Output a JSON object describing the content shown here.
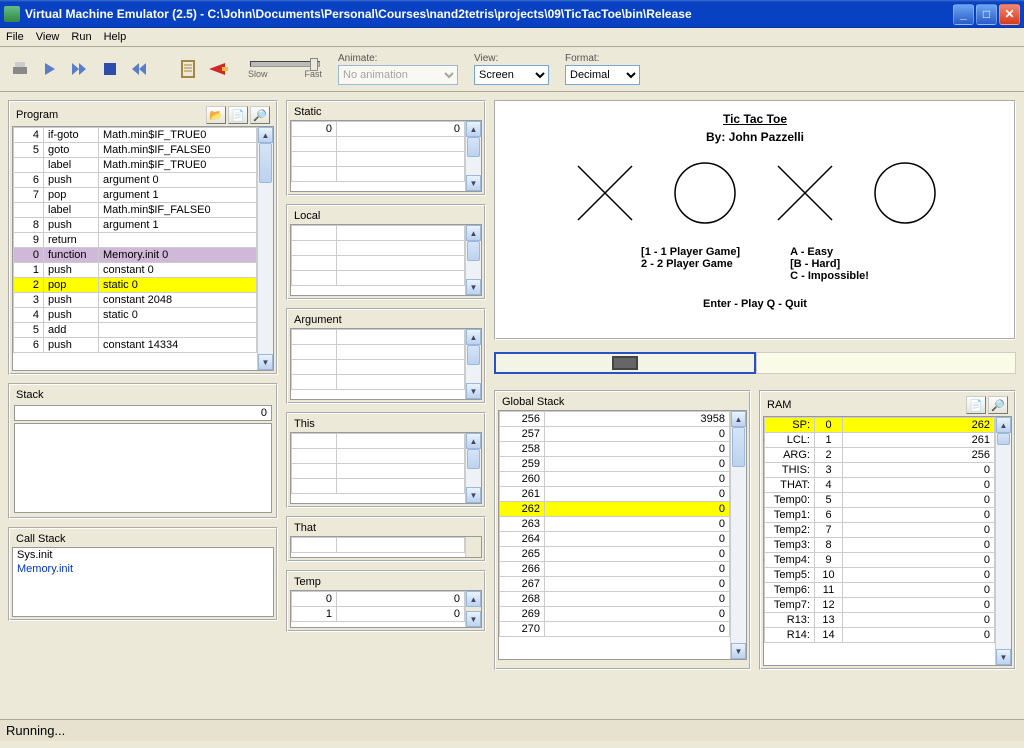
{
  "window": {
    "title": "Virtual Machine Emulator (2.5) - C:\\John\\Documents\\Personal\\Courses\\nand2tetris\\projects\\09\\TicTacToe\\bin\\Release"
  },
  "menu": {
    "file": "File",
    "view": "View",
    "run": "Run",
    "help": "Help"
  },
  "toolbar": {
    "animate": "Animate:",
    "no_animation": "No animation",
    "view": "View:",
    "screen": "Screen",
    "format": "Format:",
    "decimal": "Decimal",
    "slow": "Slow",
    "fast": "Fast"
  },
  "panels": {
    "program": "Program",
    "static": "Static",
    "local": "Local",
    "argument": "Argument",
    "this": "This",
    "that": "That",
    "temp": "Temp",
    "stack": "Stack",
    "callstack": "Call Stack",
    "globalstack": "Global Stack",
    "ram": "RAM"
  },
  "program": {
    "rows": [
      {
        "i": "4",
        "op": "if-goto",
        "arg": "Math.min$IF_TRUE0"
      },
      {
        "i": "5",
        "op": "goto",
        "arg": "Math.min$IF_FALSE0"
      },
      {
        "i": "",
        "op": "label",
        "arg": "Math.min$IF_TRUE0"
      },
      {
        "i": "6",
        "op": "push",
        "arg": "argument 0"
      },
      {
        "i": "7",
        "op": "pop",
        "arg": "argument 1"
      },
      {
        "i": "",
        "op": "label",
        "arg": "Math.min$IF_FALSE0"
      },
      {
        "i": "8",
        "op": "push",
        "arg": "argument 1"
      },
      {
        "i": "9",
        "op": "return",
        "arg": ""
      },
      {
        "i": "0",
        "op": "function",
        "arg": "Memory.init 0",
        "cls": "hl-purple"
      },
      {
        "i": "1",
        "op": "push",
        "arg": "constant 0"
      },
      {
        "i": "2",
        "op": "pop",
        "arg": "static 0",
        "cls": "hl-yellow"
      },
      {
        "i": "3",
        "op": "push",
        "arg": "constant 2048"
      },
      {
        "i": "4",
        "op": "push",
        "arg": "static 0"
      },
      {
        "i": "5",
        "op": "add",
        "arg": ""
      },
      {
        "i": "6",
        "op": "push",
        "arg": "constant 14334"
      }
    ]
  },
  "static": [
    {
      "k": "0",
      "v": "0"
    },
    {
      "k": "",
      "v": ""
    },
    {
      "k": "",
      "v": ""
    },
    {
      "k": "",
      "v": ""
    }
  ],
  "local": [
    {
      "k": "",
      "v": ""
    },
    {
      "k": "",
      "v": ""
    },
    {
      "k": "",
      "v": ""
    },
    {
      "k": "",
      "v": ""
    }
  ],
  "argument": [
    {
      "k": "",
      "v": ""
    },
    {
      "k": "",
      "v": ""
    },
    {
      "k": "",
      "v": ""
    },
    {
      "k": "",
      "v": ""
    }
  ],
  "this": [
    {
      "k": "",
      "v": ""
    },
    {
      "k": "",
      "v": ""
    },
    {
      "k": "",
      "v": ""
    },
    {
      "k": "",
      "v": ""
    }
  ],
  "that": [
    {
      "k": "",
      "v": ""
    }
  ],
  "temp": [
    {
      "k": "0",
      "v": "0"
    },
    {
      "k": "1",
      "v": "0"
    }
  ],
  "stack": {
    "value": "0"
  },
  "callstack": [
    "Sys.init",
    "Memory.init"
  ],
  "globalstack": [
    {
      "k": "256",
      "v": "3958"
    },
    {
      "k": "257",
      "v": "0"
    },
    {
      "k": "258",
      "v": "0"
    },
    {
      "k": "259",
      "v": "0"
    },
    {
      "k": "260",
      "v": "0"
    },
    {
      "k": "261",
      "v": "0"
    },
    {
      "k": "262",
      "v": "0",
      "cls": "hl-yellow"
    },
    {
      "k": "263",
      "v": "0"
    },
    {
      "k": "264",
      "v": "0"
    },
    {
      "k": "265",
      "v": "0"
    },
    {
      "k": "266",
      "v": "0"
    },
    {
      "k": "267",
      "v": "0"
    },
    {
      "k": "268",
      "v": "0"
    },
    {
      "k": "269",
      "v": "0"
    },
    {
      "k": "270",
      "v": "0"
    }
  ],
  "ram": [
    {
      "k": "SP:",
      "a": "0",
      "v": "262",
      "cls": "hl-yellow"
    },
    {
      "k": "LCL:",
      "a": "1",
      "v": "261"
    },
    {
      "k": "ARG:",
      "a": "2",
      "v": "256"
    },
    {
      "k": "THIS:",
      "a": "3",
      "v": "0"
    },
    {
      "k": "THAT:",
      "a": "4",
      "v": "0"
    },
    {
      "k": "Temp0:",
      "a": "5",
      "v": "0"
    },
    {
      "k": "Temp1:",
      "a": "6",
      "v": "0"
    },
    {
      "k": "Temp2:",
      "a": "7",
      "v": "0"
    },
    {
      "k": "Temp3:",
      "a": "8",
      "v": "0"
    },
    {
      "k": "Temp4:",
      "a": "9",
      "v": "0"
    },
    {
      "k": "Temp5:",
      "a": "10",
      "v": "0"
    },
    {
      "k": "Temp6:",
      "a": "11",
      "v": "0"
    },
    {
      "k": "Temp7:",
      "a": "12",
      "v": "0"
    },
    {
      "k": "R13:",
      "a": "13",
      "v": "0"
    },
    {
      "k": "R14:",
      "a": "14",
      "v": "0"
    }
  ],
  "screen": {
    "title": "Tic Tac Toe",
    "byline": "By: John Pazzelli",
    "l1": "[1 - 1 Player Game]",
    "l2": " 2 - 2 Player Game",
    "r1": " A - Easy",
    "r2": "[B - Hard]",
    "r3": " C - Impossible!",
    "play": "Enter - Play       Q - Quit"
  },
  "status": "Running..."
}
